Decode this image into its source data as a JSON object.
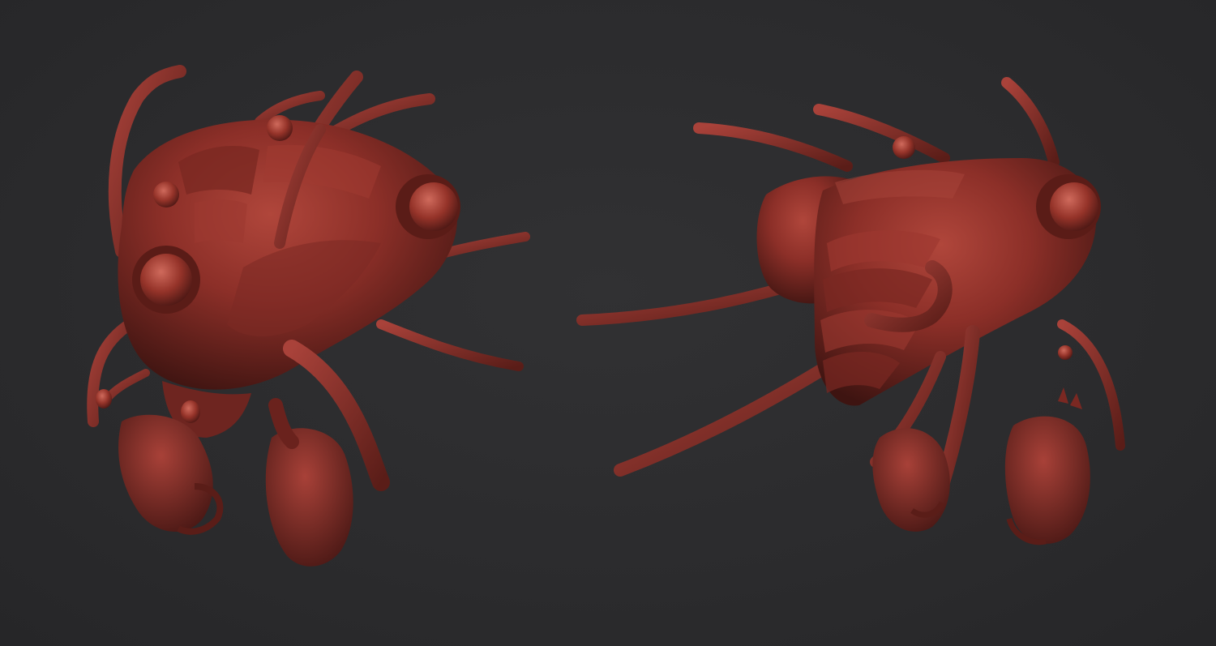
{
  "scene": {
    "background_color": "#2b2b2d",
    "material_color": "#8c2f28",
    "views": [
      {
        "name": "creature-three-quarter-front-view"
      },
      {
        "name": "creature-side-view"
      }
    ]
  }
}
